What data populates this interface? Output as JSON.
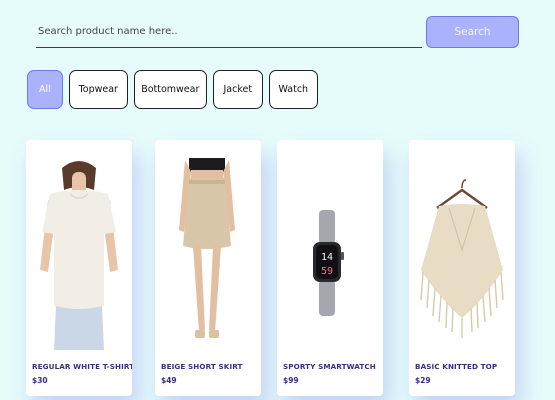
{
  "search": {
    "placeholder": "Search product name here..",
    "button_label": "Search"
  },
  "filters": [
    {
      "label": "All",
      "active": true
    },
    {
      "label": "Topwear",
      "active": false
    },
    {
      "label": "Bottomwear",
      "active": false
    },
    {
      "label": "Jacket",
      "active": false
    },
    {
      "label": "Watch",
      "active": false
    }
  ],
  "products": [
    {
      "name": "REGULAR WHITE T-SHIRT",
      "price": "$30",
      "image": "white-tshirt-image"
    },
    {
      "name": "BEIGE SHORT SKIRT",
      "price": "$49",
      "image": "beige-skirt-image"
    },
    {
      "name": "SPORTY SMARTWATCH",
      "price": "$99",
      "image": "smartwatch-image"
    },
    {
      "name": "BASIC KNITTED TOP",
      "price": "$29",
      "image": "knitted-top-image"
    }
  ],
  "watch_display": {
    "hour": "14",
    "minute": "59"
  },
  "colors": {
    "background": "#e6fcfb",
    "accent": "#a9b2fb",
    "product_text": "#3b2e7e"
  }
}
